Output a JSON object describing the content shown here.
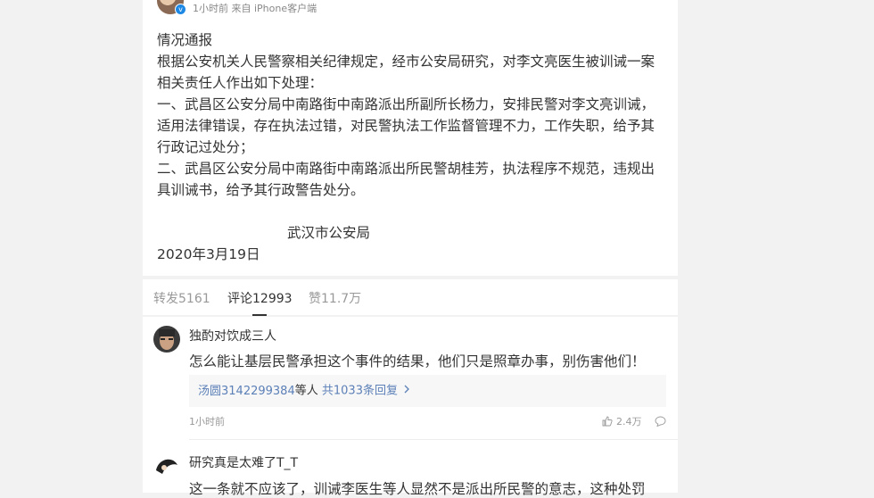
{
  "post": {
    "meta": "1小时前 来自 iPhone客户端",
    "title": "情况通报",
    "paragraphs": [
      "根据公安机关人民警察相关纪律规定，经市公安局研究，对李文亮医生被训诫一案相关责任人作出如下处理：",
      "一、武昌区公安分局中南路街中南路派出所副所长杨力，安排民警对李文亮训诫，适用法律错误，存在执法过错，对民警执法工作监督管理不力，工作失职，给予其行政记过处分；",
      "二、武昌区公安分局中南路街中南路派出所民警胡桂芳，执法程序不规范，违规出具训诫书，给予其行政警告处分。"
    ],
    "signer": "武汉市公安局",
    "date": "2020年3月19日"
  },
  "tabs": [
    {
      "label": "转发5161"
    },
    {
      "label": "评论12993"
    },
    {
      "label": "赞11.7万"
    }
  ],
  "comments": [
    {
      "user": "独酌对饮成三人",
      "text": "怎么能让基层民警承担这个事件的结果，他们只是照章办事，别伤害他们！",
      "reply_users": "汤圆3142299384",
      "reply_mid": "等人",
      "reply_count": "共1033条回复",
      "time": "1小时前",
      "likes": "2.4万"
    },
    {
      "user": "研究真是太难了T_T",
      "text": "这一条就不应该了，训诫李医生等人显然不是派出所民警的意志，这种处罚"
    }
  ]
}
